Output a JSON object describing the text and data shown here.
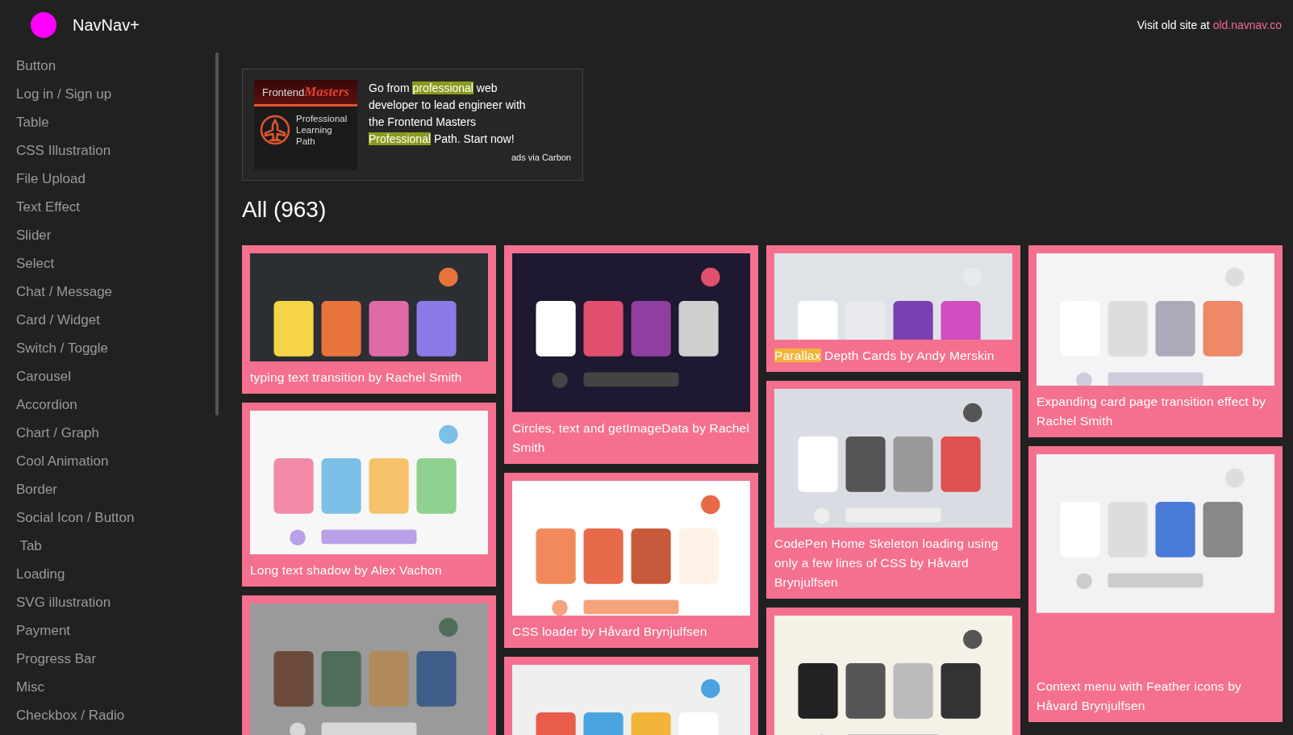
{
  "header": {
    "brand": "NavNav+",
    "visit_text": "Visit old site at",
    "visit_link": "old.navnav.co"
  },
  "sidebar": {
    "items": [
      "Button",
      "Log in / Sign up",
      "Table",
      "CSS Illustration",
      "File Upload",
      "Text Effect",
      "Slider",
      "Select",
      "Chat / Message",
      "Card / Widget",
      "Switch / Toggle",
      "Carousel",
      "Accordion",
      "Chart / Graph",
      "Cool Animation",
      "Border",
      "Social Icon / Button",
      " Tab",
      "Loading",
      "SVG illustration",
      "Payment",
      "Progress Bar",
      "Misc",
      "Checkbox / Radio"
    ]
  },
  "ad": {
    "logo_text": "Frontend",
    "logo_script": "Masters",
    "badge_text": "Professional Learning Path",
    "text": [
      {
        "text": "Go from ",
        "highlight": false
      },
      {
        "text": "professional",
        "highlight": true
      },
      {
        "text": " web developer to lead engineer with the Frontend Masters ",
        "highlight": false
      },
      {
        "text": "Professional",
        "highlight": true
      },
      {
        "text": " Path. Start now!",
        "highlight": false
      }
    ],
    "via": "ads via Carbon"
  },
  "heading": "All (963)",
  "columns": [
    [
      {
        "caption": [
          {
            "text": "typing text transition by Rachel Smith",
            "highlight": false
          }
        ]
      },
      {
        "caption": [
          {
            "text": "Long text shadow by Alex Vachon",
            "highlight": false
          }
        ]
      },
      {}
    ],
    [
      {
        "caption": [
          {
            "text": "Circles, text and getImageData by Rachel Smith",
            "highlight": false
          }
        ]
      },
      {
        "caption": [
          {
            "text": "CSS loader by Håvard Brynjulfsen",
            "highlight": false
          }
        ]
      },
      {}
    ],
    [
      {
        "caption": [
          {
            "text": "Parallax",
            "highlight": true
          },
          {
            "text": " Depth Cards by Andy Merskin",
            "highlight": false
          }
        ]
      },
      {
        "caption": [
          {
            "text": "CodePen Home Skeleton loading using only a few lines of CSS by Håvard Brynjulfsen",
            "highlight": false
          }
        ]
      },
      {}
    ],
    [
      {
        "caption": [
          {
            "text": "Expanding card page transition effect by Rachel Smith",
            "highlight": false
          }
        ]
      },
      {
        "caption": [
          {
            "text": "Context menu with Feather icons by Håvard Brynjulfsen",
            "highlight": false
          }
        ]
      }
    ]
  ]
}
